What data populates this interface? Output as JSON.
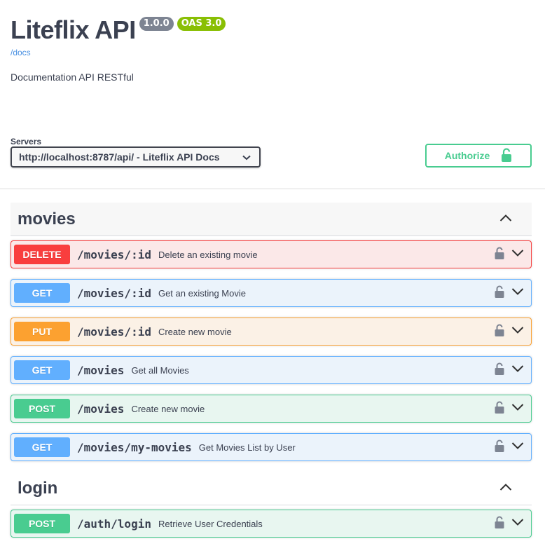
{
  "info": {
    "title": "Liteflix API",
    "version_badge": "1.0.0",
    "oas_badge": "OAS 3.0",
    "docs_link": "/docs",
    "description": "Documentation API RESTful"
  },
  "servers": {
    "label": "Servers",
    "selected": "http://localhost:8787/api/ - Liteflix API Docs"
  },
  "authorize": {
    "label": "Authorize"
  },
  "colors": {
    "delete": "#f93e3e",
    "get": "#61affe",
    "put": "#fca130",
    "post": "#49cc90"
  },
  "tags": [
    {
      "name": "movies",
      "operations": [
        {
          "method": "DELETE",
          "path": "/movies/:id",
          "summary": "Delete an existing movie"
        },
        {
          "method": "GET",
          "path": "/movies/:id",
          "summary": "Get an existing Movie"
        },
        {
          "method": "PUT",
          "path": "/movies/:id",
          "summary": "Create new movie"
        },
        {
          "method": "GET",
          "path": "/movies",
          "summary": "Get all Movies"
        },
        {
          "method": "POST",
          "path": "/movies",
          "summary": "Create new movie"
        },
        {
          "method": "GET",
          "path": "/movies/my-movies",
          "summary": "Get Movies List by User"
        }
      ]
    },
    {
      "name": "login",
      "operations": [
        {
          "method": "POST",
          "path": "/auth/login",
          "summary": "Retrieve User Credentials"
        }
      ]
    }
  ]
}
